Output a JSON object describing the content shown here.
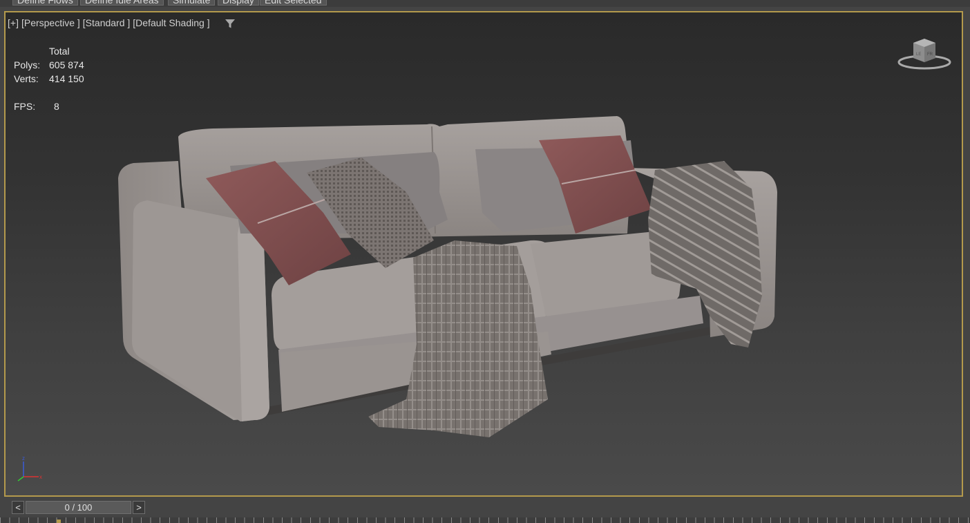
{
  "toolbar": {
    "tabs": [
      "Define Flows",
      "Define Idle Areas",
      "Simulate",
      "Display",
      "Edit Selected"
    ]
  },
  "viewport": {
    "label_plus": "[+]",
    "label_view": "[Perspective ]",
    "label_mode": "[Standard ]",
    "label_shading": "[Default Shading ]",
    "filter_icon": "funnel-icon",
    "stats": {
      "header": "Total",
      "polys_label": "Polys:",
      "polys_value": "605 874",
      "verts_label": "Verts:",
      "verts_value": "414 150",
      "fps_label": "FPS:",
      "fps_value": "8"
    },
    "viewcube_icon": "viewcube-icon",
    "gizmo_icon": "axis-gizmo-icon",
    "border_color": "#b49a4c"
  },
  "timeline": {
    "prev_label": "<",
    "frame": "0 / 100",
    "next_label": ">"
  }
}
